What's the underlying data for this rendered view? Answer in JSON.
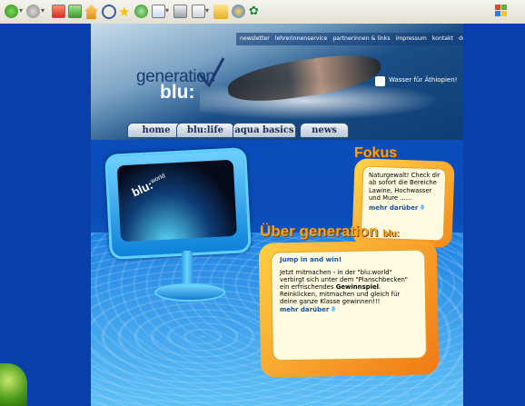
{
  "browser": {
    "icons": [
      "back-icon",
      "forward-icon",
      "stop-icon",
      "refresh-icon",
      "home-icon",
      "search-icon",
      "favorites-icon",
      "history-icon",
      "mail-icon",
      "print-icon",
      "edit-icon",
      "folder-icon",
      "messenger-icon",
      "extra-icon"
    ]
  },
  "site": {
    "top_links": [
      "newsletter",
      "lehrerinnenservice",
      "partnerinnen & links",
      "impressum",
      "kontakt",
      "downloads"
    ],
    "logo_generation": "generation",
    "logo_blu": "blu:",
    "wasser_link": "Wasser für Äthiopien!",
    "nav": [
      "home",
      "blu:life",
      "aqua basics",
      "news"
    ],
    "monitor_label": "blu:",
    "monitor_sup": "world",
    "fokus": {
      "title": "Fokus",
      "text": "Naturgewalt!  Check dir ab sofort die Bereiche Lawine, Hochwasser und Mure ......",
      "more": "mehr darüber"
    },
    "uber": {
      "title_main": "Über generation",
      "title_small": "blu:",
      "heading": "Jump in and win!",
      "text_before": "Jetzt mitmachen - in der \"blu:world\" verbirgt sich unter dem \"Planschbecken\" ein erfrischendes ",
      "text_bold": "Gewinnspiel",
      "text_after": ". Reinklicken, mitmachen und gleich für deine ganze Klasse gewinnen!!!",
      "more": "mehr darüber"
    }
  },
  "colors": {
    "page_bg": "#0a3ea8",
    "accent_orange": "#f4a41a",
    "link_blue": "#1752a6"
  }
}
